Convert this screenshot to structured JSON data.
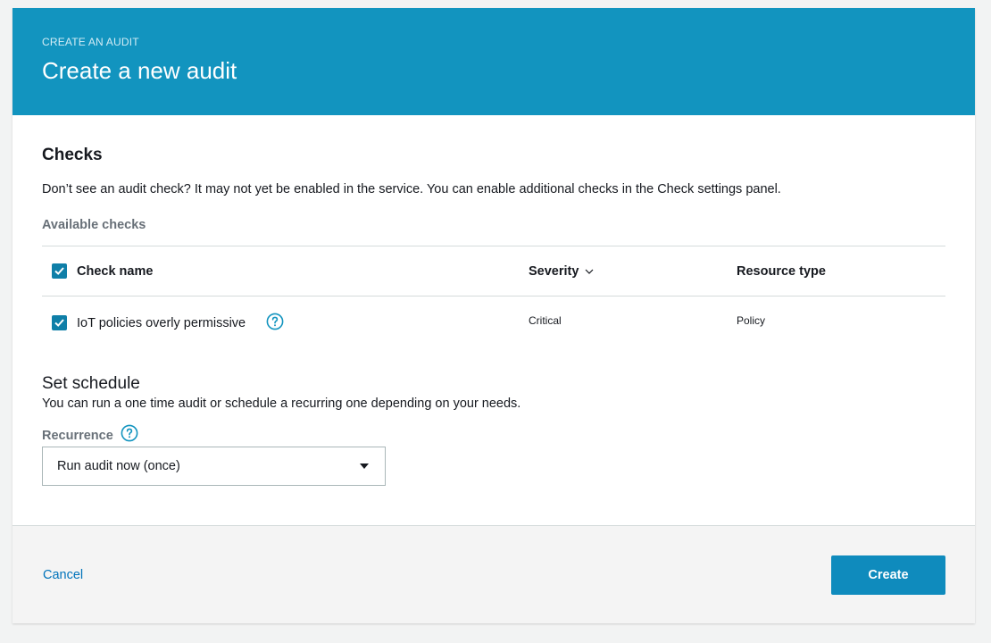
{
  "header": {
    "eyebrow": "CREATE AN AUDIT",
    "title": "Create a new audit"
  },
  "checks": {
    "heading": "Checks",
    "description": "Don’t see an audit check? It may not yet be enabled in the service. You can enable additional checks in the Check settings panel.",
    "available_label": "Available checks",
    "columns": {
      "check_name": "Check name",
      "severity": "Severity",
      "resource_type": "Resource type"
    },
    "rows": [
      {
        "name": "IoT policies overly permissive",
        "severity": "Critical",
        "resource_type": "Policy",
        "checked": true
      }
    ],
    "select_all_checked": true
  },
  "schedule": {
    "heading": "Set schedule",
    "description": "You can run a one time audit or schedule a recurring one depending on your needs.",
    "recurrence_label": "Recurrence",
    "recurrence_value": "Run audit now (once)"
  },
  "footer": {
    "cancel_label": "Cancel",
    "create_label": "Create"
  },
  "colors": {
    "banner": "#1294bf",
    "accent": "#0f7fa8",
    "link": "#0073bb",
    "primary_button": "#0f8bbd"
  },
  "icons": [
    "check-icon",
    "help-icon",
    "chevron-down-icon",
    "caret-down-icon"
  ]
}
